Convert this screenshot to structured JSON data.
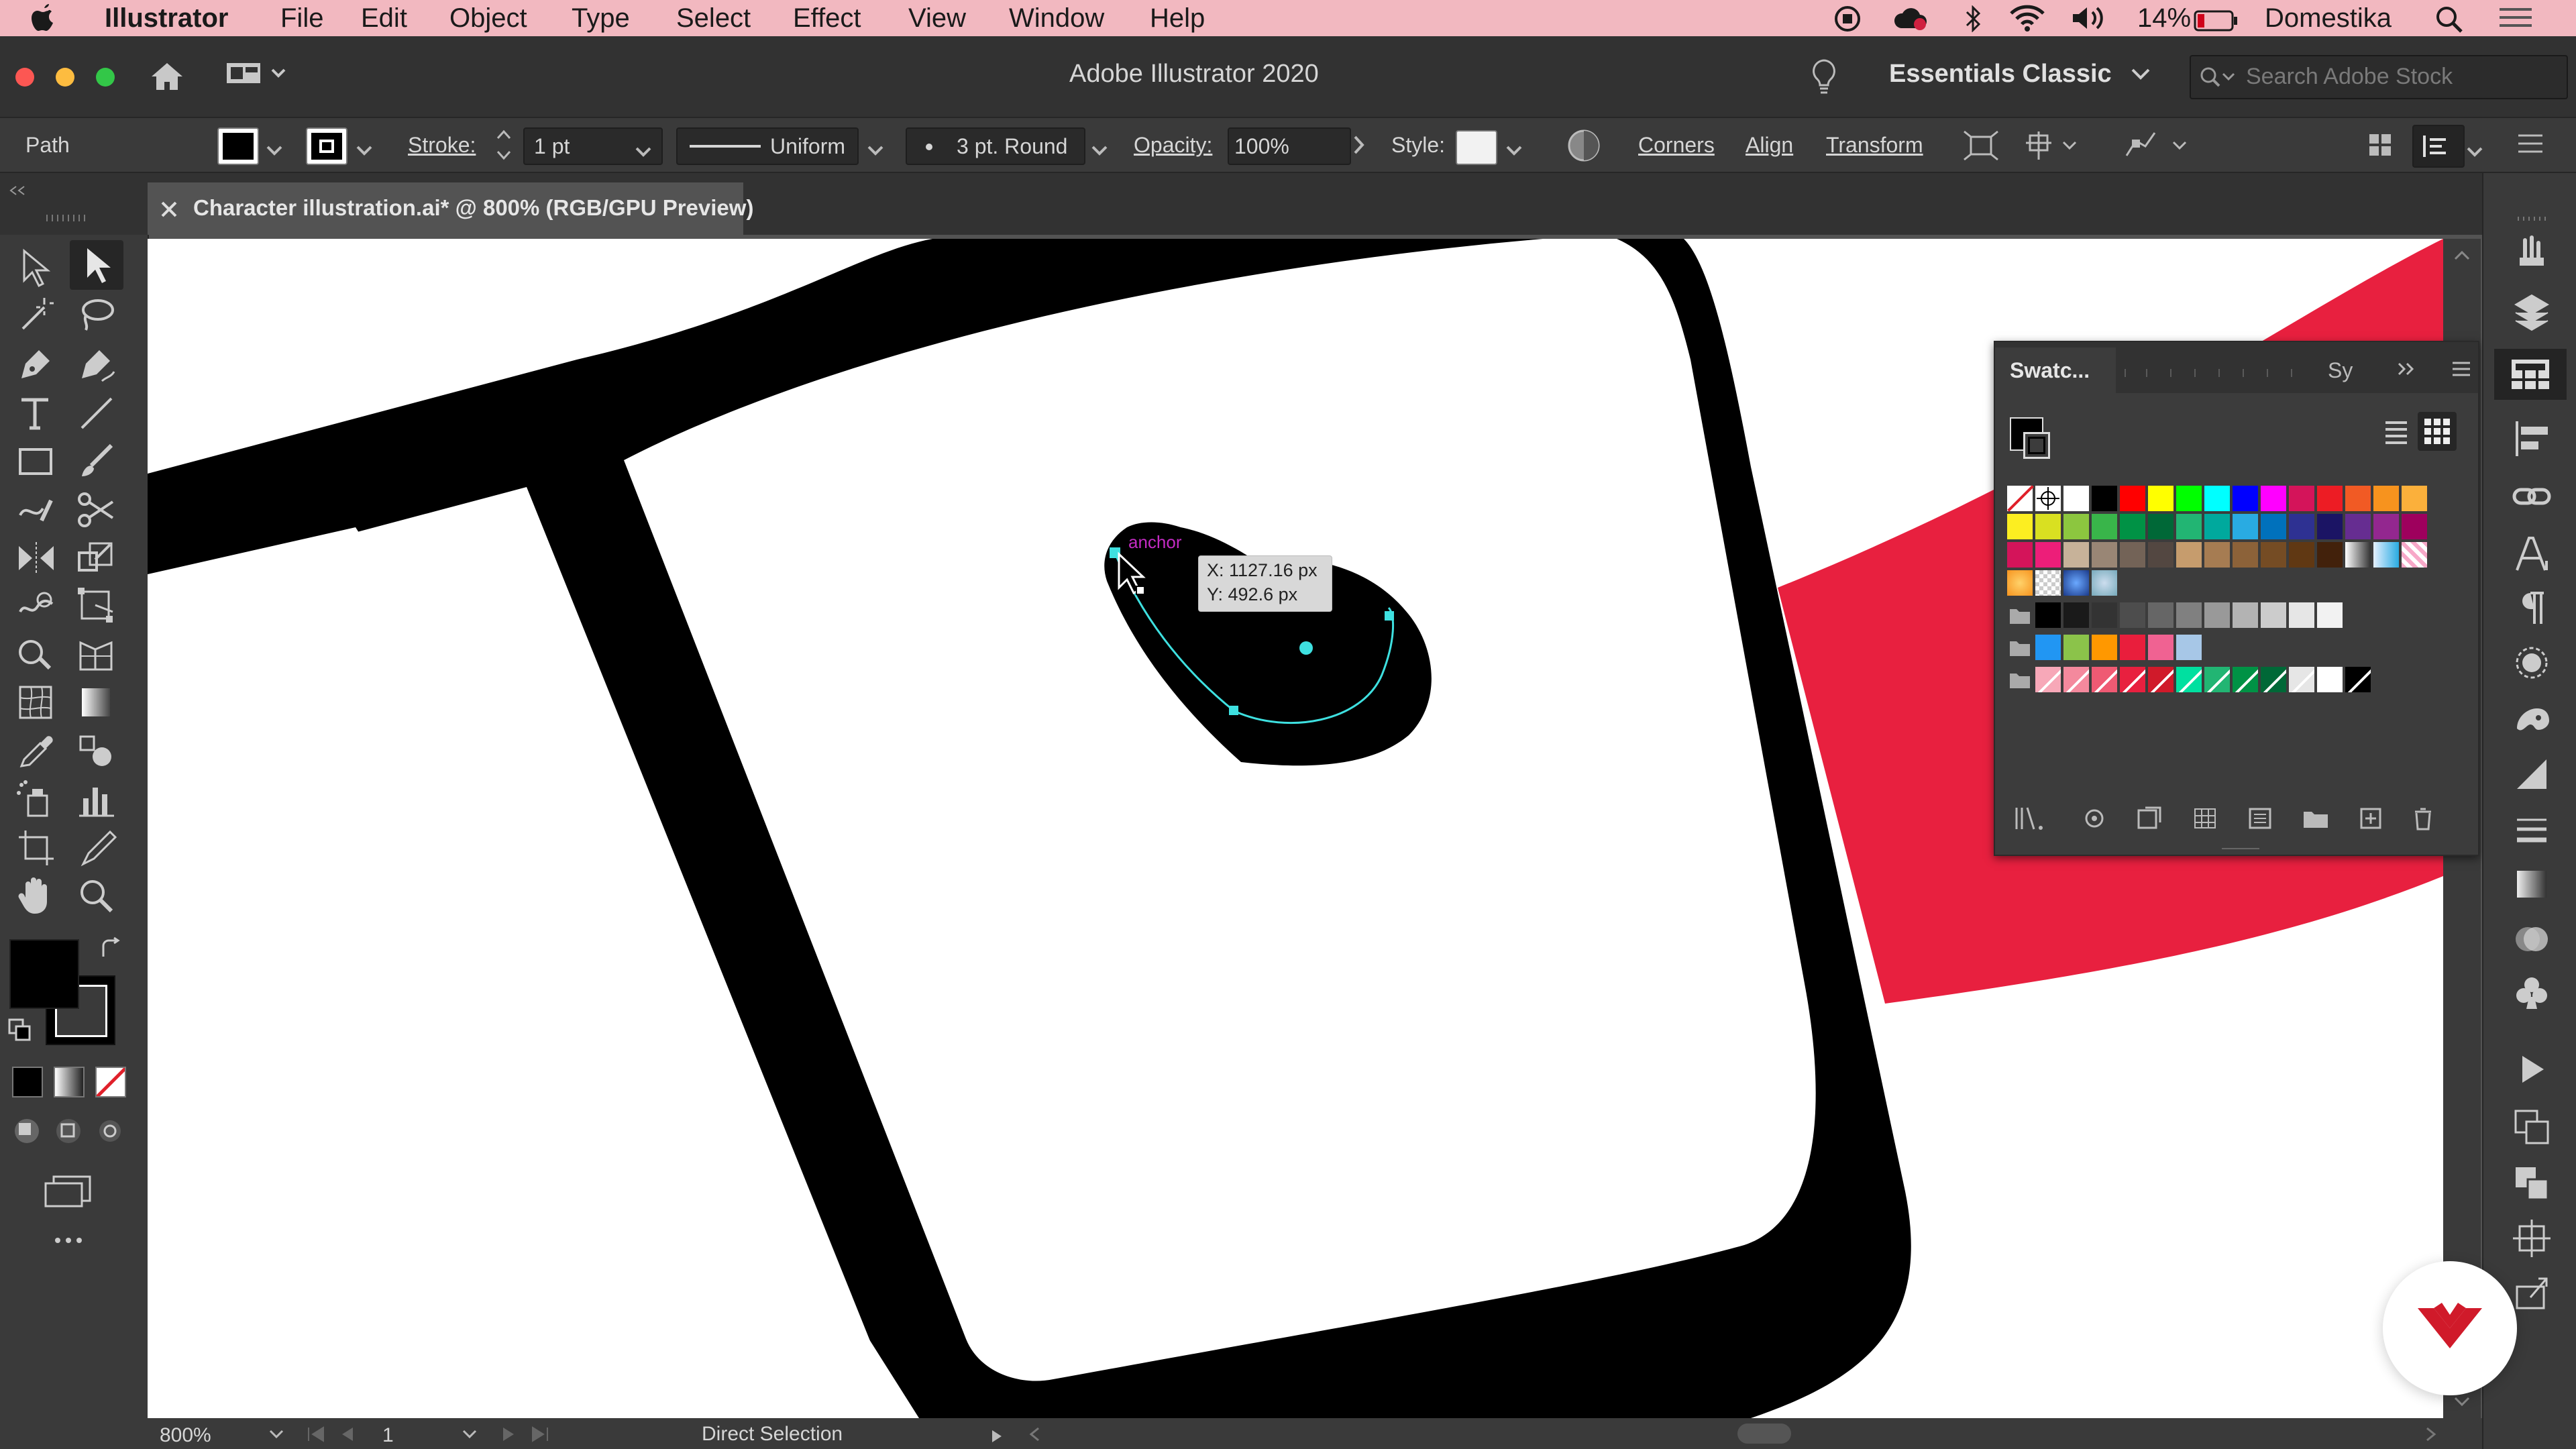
{
  "menubar": {
    "app": "Illustrator",
    "items": [
      "File",
      "Edit",
      "Object",
      "Type",
      "Select",
      "Effect",
      "View",
      "Window",
      "Help"
    ],
    "battery": "14%",
    "user": "Domestika"
  },
  "titlebar": {
    "title": "Adobe Illustrator 2020",
    "workspace": "Essentials Classic",
    "search_placeholder": "Search Adobe Stock"
  },
  "control": {
    "selection_type": "Path",
    "stroke_label": "Stroke:",
    "stroke_weight": "1 pt",
    "profile": "Uniform",
    "brush": "3 pt. Round",
    "opacity_label": "Opacity:",
    "opacity": "100%",
    "style_label": "Style:",
    "corners": "Corners",
    "align": "Align",
    "transform": "Transform"
  },
  "document": {
    "tab_title": "Character illustration.ai* @ 800% (RGB/GPU Preview)"
  },
  "canvas": {
    "anchor_label": "anchor",
    "coord_x": "X: 1127.16 px",
    "coord_y": "Y: 492.6 px"
  },
  "swatches": {
    "tab1": "Swatc...",
    "tab2": "Sy"
  },
  "status": {
    "zoom": "800%",
    "artboard": "1",
    "tool": "Direct Selection"
  },
  "colors": {
    "menubar_bg": "#f2b8c0",
    "accent_red": "#e8203f",
    "selection_cyan": "#3ee0e0",
    "anchor_magenta": "#c42bc4"
  }
}
